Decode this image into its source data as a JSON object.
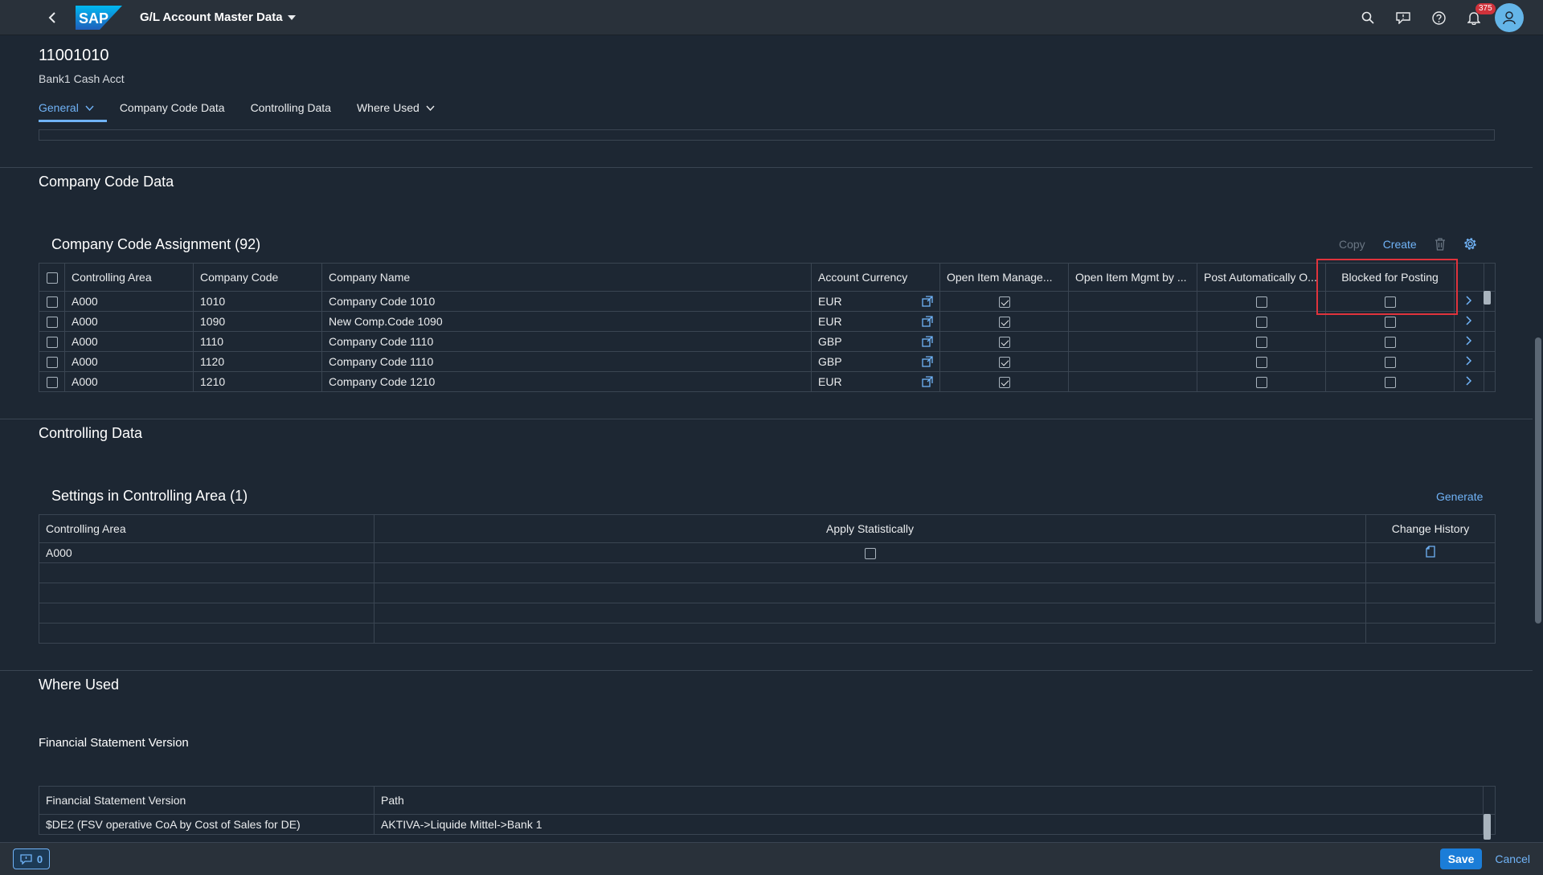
{
  "shell": {
    "app_title": "G/L Account Master Data",
    "notification_count": "375"
  },
  "header": {
    "title": "11001010",
    "subtitle": "Bank1 Cash Acct",
    "tabs": [
      {
        "label": "General",
        "active": true,
        "dropdown": true
      },
      {
        "label": "Company Code Data",
        "active": false,
        "dropdown": false
      },
      {
        "label": "Controlling Data",
        "active": false,
        "dropdown": false
      },
      {
        "label": "Where Used",
        "active": false,
        "dropdown": true
      }
    ]
  },
  "company_code": {
    "section_title": "Company Code Data",
    "table_title": "Company Code Assignment (92)",
    "toolbar": {
      "copy": "Copy",
      "create": "Create"
    },
    "columns": [
      "Controlling Area",
      "Company Code",
      "Company Name",
      "Account Currency",
      "Open Item Manage...",
      "Open Item Mgmt by ...",
      "Post Automatically O...",
      "Blocked for Posting"
    ],
    "rows": [
      {
        "area": "A000",
        "code": "1010",
        "name": "Company Code 1010",
        "currency": "EUR",
        "open_item": true,
        "post_auto": false,
        "blocked": false
      },
      {
        "area": "A000",
        "code": "1090",
        "name": "New Comp.Code 1090",
        "currency": "EUR",
        "open_item": true,
        "post_auto": false,
        "blocked": false
      },
      {
        "area": "A000",
        "code": "1110",
        "name": "Company Code 1110",
        "currency": "GBP",
        "open_item": true,
        "post_auto": false,
        "blocked": false
      },
      {
        "area": "A000",
        "code": "1120",
        "name": "Company Code 1110",
        "currency": "GBP",
        "open_item": true,
        "post_auto": false,
        "blocked": false
      },
      {
        "area": "A000",
        "code": "1210",
        "name": "Company Code 1210",
        "currency": "EUR",
        "open_item": true,
        "post_auto": false,
        "blocked": false
      }
    ]
  },
  "controlling": {
    "section_title": "Controlling Data",
    "table_title": "Settings in Controlling Area (1)",
    "toolbar": {
      "generate": "Generate"
    },
    "columns": [
      "Controlling Area",
      "Apply Statistically",
      "Change History"
    ],
    "rows": [
      {
        "area": "A000",
        "apply_statistically": false
      }
    ]
  },
  "where_used": {
    "section_title": "Where Used",
    "subsection_title": "Financial Statement Version",
    "columns": [
      "Financial Statement Version",
      "Path"
    ],
    "rows": [
      {
        "version": "$DE2 (FSV operative CoA by Cost of Sales for DE)",
        "path": "AKTIVA->Liquide Mittel->Bank 1"
      }
    ]
  },
  "footer": {
    "message_count": "0",
    "save": "Save",
    "cancel": "Cancel"
  },
  "colors": {
    "accent": "#70b3f7",
    "background": "#1d2733",
    "shell": "#29313a",
    "highlight": "#e0333c"
  }
}
